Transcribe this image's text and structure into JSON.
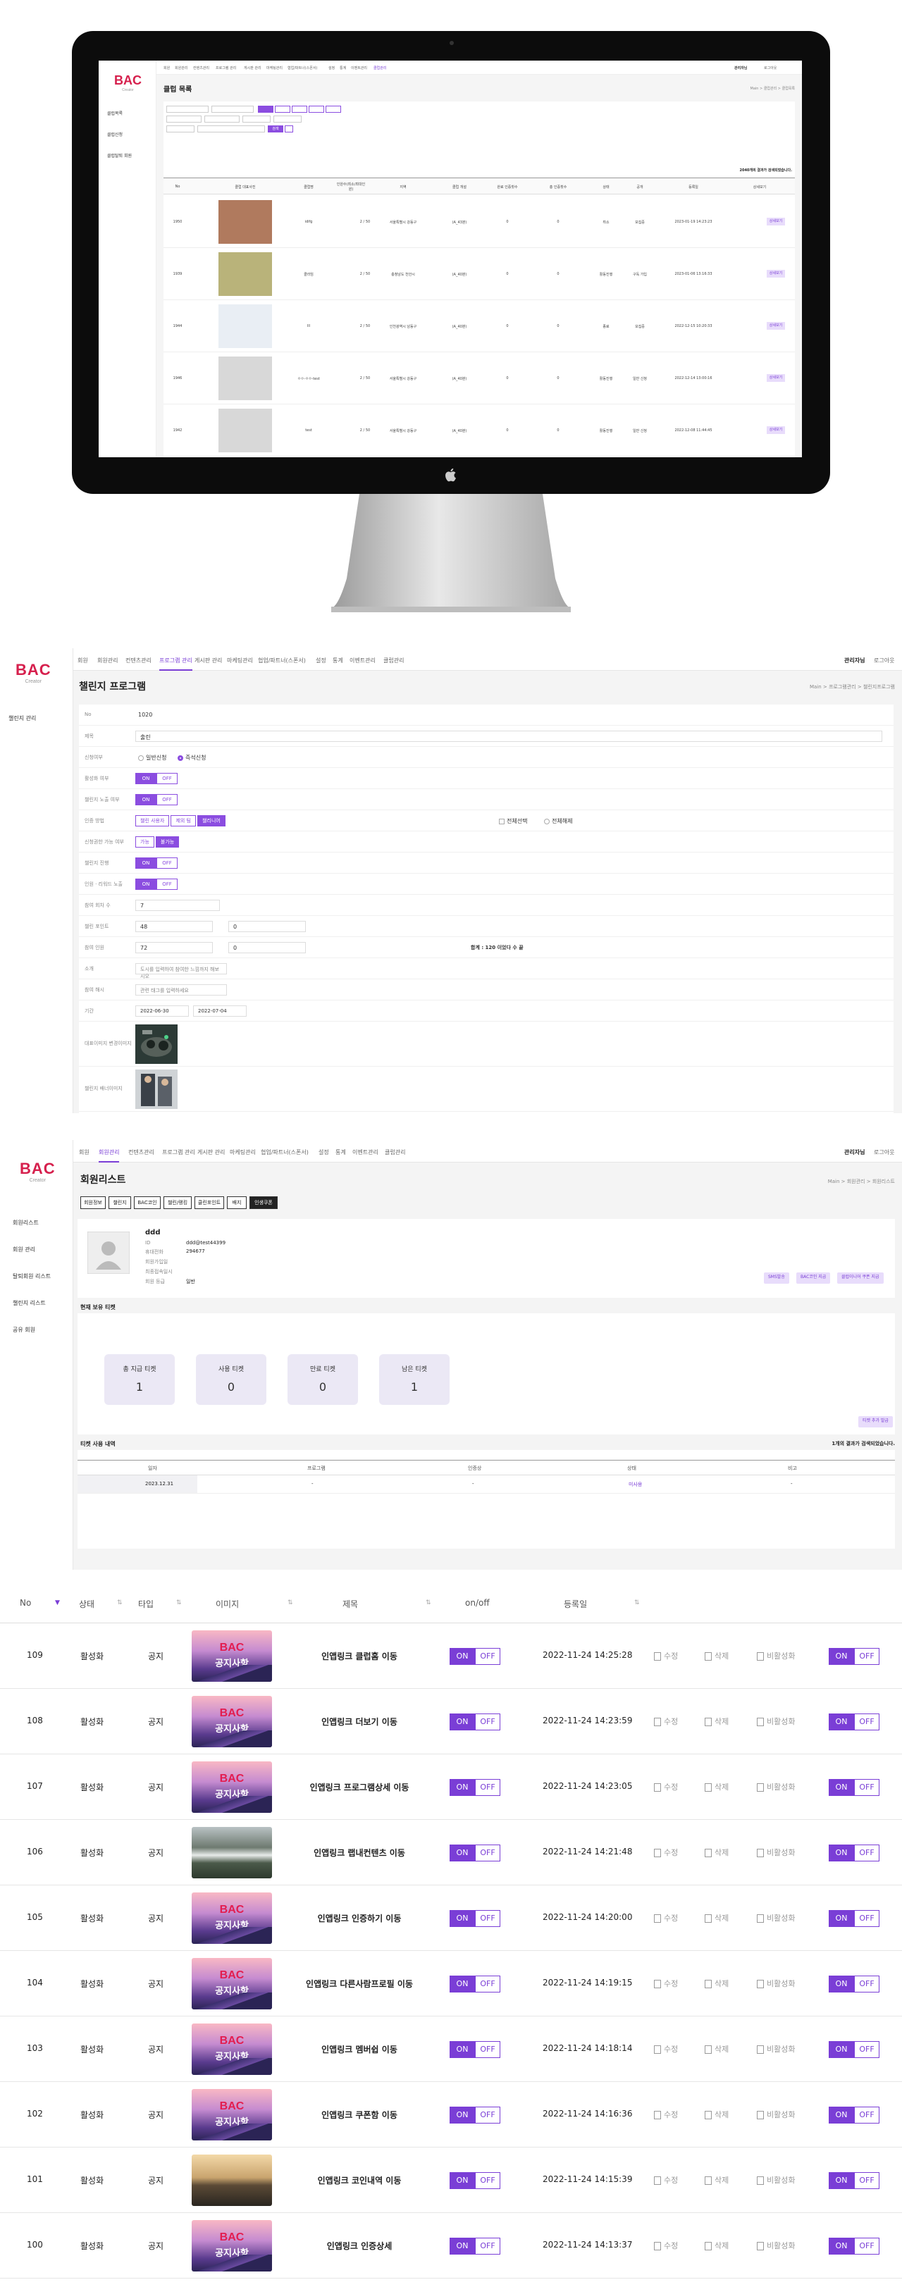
{
  "sec1": {
    "logo": "BAC",
    "logo_sub": "Creator",
    "sidebar": [
      "클럽목록",
      "클럽신청",
      "클럽탈퇴 회원"
    ],
    "nav": [
      "회원",
      "회원관리",
      "컨텐츠관리",
      "프로그램 관리",
      "게시판 관리",
      "마케팅관리",
      "협업/파트너(스폰서)",
      "설정",
      "통계",
      "이벤트관리",
      "클럽관리"
    ],
    "user": "관리자님",
    "logout": "로그아웃",
    "title": "클럽 목록",
    "breadcrumb": "Main > 클럽관리 > 클럽목록",
    "search_btn": "검색",
    "total": "2040개의 결과가 검색되었습니다.",
    "columns": [
      "No",
      "클럽 대표사진",
      "클럽명",
      "인원수(최소/최대인원)",
      "지역",
      "클럽 개설",
      "완료 인증횟수",
      "총 인증횟수",
      "상태",
      "공개",
      "등록일",
      "상세보기"
    ],
    "rows": [
      {
        "no": "1950",
        "name": "idifg",
        "size": "2 / 50",
        "region": "서울특별시 강동구",
        "open": "(A_43분)",
        "c1": "0",
        "c2": "0",
        "status": "취소",
        "vis": "모집중",
        "date": "2023-01-19 14:23:23",
        "btn": "상세보기"
      },
      {
        "no": "1939",
        "name": "클라임",
        "size": "2 / 50",
        "region": "충청남도 천안시",
        "open": "(A_40분)",
        "c1": "0",
        "c2": "0",
        "status": "활동진행",
        "vis": "구독 가입",
        "date": "2023-01-06 13:16:33",
        "btn": "상세보기"
      },
      {
        "no": "1944",
        "name": "lll",
        "size": "2 / 50",
        "region": "인천광역시 남동구",
        "open": "(A_40분)",
        "c1": "0",
        "c2": "0",
        "status": "종료",
        "vis": "모집중",
        "date": "2022-12-15 10:20:33",
        "btn": "상세보기"
      },
      {
        "no": "1946",
        "name": "ㅇㅇ-ㅇㅇ-test",
        "size": "2 / 50",
        "region": "서울특별시 강동구",
        "open": "(A_40분)",
        "c1": "0",
        "c2": "0",
        "status": "활동진행",
        "vis": "일반 신청",
        "date": "2022-12-14 13:00:16",
        "btn": "상세보기"
      },
      {
        "no": "1942",
        "name": "test",
        "size": "2 / 50",
        "region": "서울특별시 강동구",
        "open": "(A_40분)",
        "c1": "0",
        "c2": "0",
        "status": "활동진행",
        "vis": "일반 신청",
        "date": "2022-12-08 11:44:45",
        "btn": "상세보기"
      }
    ]
  },
  "sec2": {
    "logo": "BAC",
    "logo_sub": "Creator",
    "sidebar_item": "챌린지 관리",
    "nav": [
      "회원",
      "회원관리",
      "컨텐츠관리",
      "프로그램 관리",
      "게시판 관리",
      "마케팅관리",
      "협업/파트너(스폰서)",
      "설정",
      "통계",
      "이벤트관리",
      "클럽관리"
    ],
    "user": "관리자님",
    "logout": "로그아웃",
    "title": "챌린지 프로그램",
    "breadcrumb": "Main > 프로그램관리 > 챌린지프로그램",
    "fields": {
      "no_label": "No",
      "no_value": "1020",
      "name_label": "제목",
      "name_value": "출린",
      "type_label": "신청여부",
      "type_opt1": "일반신청",
      "type_opt2": "즉석신청",
      "public_label": "활성화 여부",
      "expose_label": "챌린지 노출 여부",
      "auth_label": "인증 방법",
      "auth_opt1": "챌린 사용자",
      "auth_opt2": "제외 팀",
      "auth_opt3": "챌리니어",
      "cond_label": "리워드 조건",
      "cond_opt1": "전체선택",
      "cond_opt2": "전체해제",
      "pay_label": "신청권한 가능 여부",
      "pay_opt1": "가능",
      "pay_opt2": "불가능",
      "prog_label": "챌린지 진행",
      "reward_label": "인원 · 리워드 노출",
      "round_label": "참여 회차 수",
      "round_value": "7",
      "prize_label": "챌린 포인트",
      "prize_v1": "48",
      "prize_v2": "0",
      "limit_label": "참여 인원",
      "limit_v1": "72",
      "limit_v2": "0",
      "limit_note": "합계 : 120 이었다 수 끝",
      "desc_label": "소개",
      "desc_value": "도시를 입력하여 참여한 느낌까지 해보시오",
      "tag_label": "참여 해시",
      "tag_value": "관련 태그를 입력하세요",
      "period_label": "기간",
      "period_from": "2022-06-30",
      "period_to": "2022-07-04",
      "img1_label": "대표이미지 변경이미지",
      "img2_label": "챌린지 배너이미지"
    },
    "on": "ON",
    "off": "OFF"
  },
  "sec3": {
    "logo": "BAC",
    "logo_sub": "Creator",
    "sidebar": [
      "회원리스트",
      "회원 관리",
      "탈퇴회원 리스트",
      "챌린지 리스트",
      "공유 회원"
    ],
    "nav": [
      "회원",
      "회원관리",
      "컨텐츠관리",
      "프로그램 관리",
      "게시판 관리",
      "마케팅관리",
      "협업/파트너(스폰서)",
      "설정",
      "통계",
      "이벤트관리",
      "클럽관리"
    ],
    "user": "관리자님",
    "logout": "로그아웃",
    "title": "회원리스트",
    "breadcrumb": "Main > 회원관리 > 회원리스트",
    "tabs": [
      "회원정보",
      "챌린지",
      "BAC코인",
      "챌린/랭킹",
      "클린포인트",
      "배지",
      "인생쿠폰"
    ],
    "profile": {
      "name": "ddd",
      "id_label": "ID",
      "id": "ddd@test44399",
      "phone_label": "휴대전화",
      "phone": "294677",
      "join_label": "회원가입일",
      "last_label": "최종접속일시",
      "grade_label": "회원 등급",
      "grade": "일반"
    },
    "profile_buttons": [
      "SMS발송",
      "BAC코인 지급",
      "클럽이니어 쿠폰 지급"
    ],
    "coupon_title": "현재 보유 티켓",
    "stats": [
      {
        "label": "총 지급 티켓",
        "value": "1"
      },
      {
        "label": "사용 티켓",
        "value": "0"
      },
      {
        "label": "만료 티켓",
        "value": "0"
      },
      {
        "label": "남은 티켓",
        "value": "1"
      }
    ],
    "issue_btn": "티켓 추가 발급",
    "history_title": "티켓 사용 내역",
    "history_count": "1개의 결과가 검색되었습니다.",
    "history_cols": [
      "일자",
      "프로그램",
      "인증상",
      "상태",
      "비고"
    ],
    "history_row": {
      "date": "2023.12.31",
      "program": "-",
      "cert": "-",
      "status": "미사용",
      "note": "-"
    }
  },
  "sec4": {
    "columns": [
      "No",
      "상태",
      "타입",
      "이미지",
      "제목",
      "on/off",
      "등록일"
    ],
    "notice_bac": "BAC",
    "notice_ko": "공지사항",
    "on": "ON",
    "off": "OFF",
    "act_edit": "수정",
    "act_delete": "삭제",
    "act_disable": "비활성화",
    "rows": [
      {
        "no": "109",
        "state": "활성화",
        "type": "공지",
        "img": "notice",
        "title": "인앱링크 클럽홈 이동",
        "date": "2022-11-24 14:25:28"
      },
      {
        "no": "108",
        "state": "활성화",
        "type": "공지",
        "img": "notice",
        "title": "인앱링크 더보기 이동",
        "date": "2022-11-24 14:23:59"
      },
      {
        "no": "107",
        "state": "활성화",
        "type": "공지",
        "img": "notice",
        "title": "인앱링크 프로그램상세 이동",
        "date": "2022-11-24 14:23:05"
      },
      {
        "no": "106",
        "state": "활성화",
        "type": "공지",
        "img": "photo",
        "title": "인앱링크 랩내컨텐츠 이동",
        "date": "2022-11-24 14:21:48"
      },
      {
        "no": "105",
        "state": "활성화",
        "type": "공지",
        "img": "notice",
        "title": "인앱링크 인증하기 이동",
        "date": "2022-11-24 14:20:00"
      },
      {
        "no": "104",
        "state": "활성화",
        "type": "공지",
        "img": "notice",
        "title": "인앱링크 다른사람프로필 이동",
        "date": "2022-11-24 14:19:15"
      },
      {
        "no": "103",
        "state": "활성화",
        "type": "공지",
        "img": "notice",
        "title": "인앱링크 멤버쉽 이동",
        "date": "2022-11-24 14:18:14"
      },
      {
        "no": "102",
        "state": "활성화",
        "type": "공지",
        "img": "notice",
        "title": "인앱링크 쿠폰함 이동",
        "date": "2022-11-24 14:16:36"
      },
      {
        "no": "101",
        "state": "활성화",
        "type": "공지",
        "img": "photo2",
        "title": "인앱링크 코인내역 이동",
        "date": "2022-11-24 14:15:39"
      },
      {
        "no": "100",
        "state": "활성화",
        "type": "공지",
        "img": "notice",
        "title": "인앱링크 인증상세",
        "date": "2022-11-24 14:13:37"
      }
    ]
  }
}
